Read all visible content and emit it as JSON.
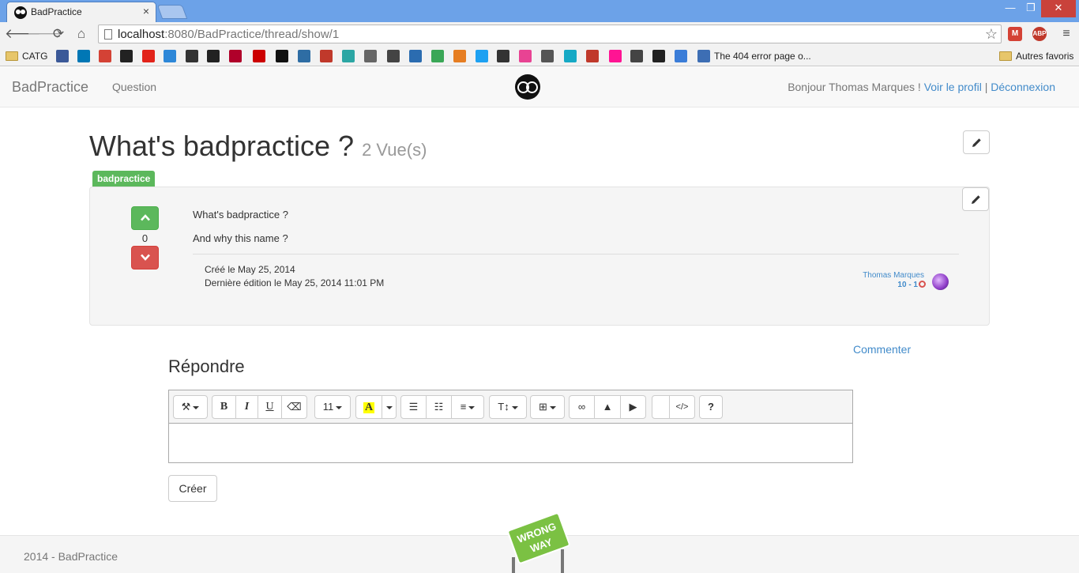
{
  "browser": {
    "tab_title": "BadPractice",
    "tab_close": "×",
    "window_min": "—",
    "window_max": "❐",
    "window_close": "✕",
    "url_host": "localhost",
    "url_rest": ":8080/BadPractice/thread/show/1",
    "bookmarks": [
      {
        "label": "CATG",
        "type": "folder"
      },
      {
        "label": "",
        "color": "#3b5998"
      },
      {
        "label": "",
        "color": "#0077b5"
      },
      {
        "label": "",
        "color": "#d44235"
      },
      {
        "label": "",
        "color": "#222222"
      },
      {
        "label": "",
        "color": "#e2231a"
      },
      {
        "label": "",
        "color": "#2d87d8"
      },
      {
        "label": "",
        "color": "#333333"
      },
      {
        "label": "",
        "color": "#222222"
      },
      {
        "label": "",
        "color": "#b0002a"
      },
      {
        "label": "",
        "color": "#cc0000"
      },
      {
        "label": "",
        "color": "#111111"
      },
      {
        "label": "",
        "color": "#2e6da4"
      },
      {
        "label": "",
        "color": "#c0392b"
      },
      {
        "label": "",
        "color": "#2ca6a4"
      },
      {
        "label": "",
        "color": "#666666"
      },
      {
        "label": "",
        "color": "#444444"
      },
      {
        "label": "",
        "color": "#2b6cb0"
      },
      {
        "label": "",
        "color": "#3aa757"
      },
      {
        "label": "",
        "color": "#e67e22"
      },
      {
        "label": "",
        "color": "#1da1f2"
      },
      {
        "label": "",
        "color": "#333333"
      },
      {
        "label": "",
        "color": "#e84393"
      },
      {
        "label": "",
        "color": "#555555"
      },
      {
        "label": "",
        "color": "#16a9c5"
      },
      {
        "label": "",
        "color": "#c0392b"
      },
      {
        "label": "",
        "color": "#ff1493"
      },
      {
        "label": "",
        "color": "#444444"
      },
      {
        "label": "",
        "color": "#222222"
      },
      {
        "label": "",
        "color": "#3b7dd8"
      },
      {
        "label": "The 404 error page o...",
        "color": "#3d6eb4"
      }
    ],
    "other_bookmarks": "Autres favoris"
  },
  "navbar": {
    "brand": "BadPractice",
    "question": "Question",
    "greeting": "Bonjour Thomas Marques ! ",
    "profile_link": "Voir le profil",
    "separator": " | ",
    "logout_link": "Déconnexion"
  },
  "thread": {
    "title": "What's badpractice ?",
    "views": "2 Vue(s)",
    "tag": "badpractice",
    "score": "0",
    "body_line1": "What's badpractice ?",
    "body_line2": "And why this name ?",
    "created": "Créé le May 25, 2014",
    "edited": "Dernière édition le May 25, 2014 11:01 PM",
    "author": "Thomas Marques",
    "author_rep": "10 - 1"
  },
  "reply": {
    "comment_link": "Commenter",
    "title": "Répondre",
    "font_size": "11",
    "create_button": "Créer"
  },
  "footer": {
    "text": "2014 - BadPractice",
    "sign_line1": "WRONG",
    "sign_line2": "WAY"
  },
  "colors": {
    "accent": "#428bca",
    "success": "#5cb85c",
    "danger": "#d9534f"
  }
}
